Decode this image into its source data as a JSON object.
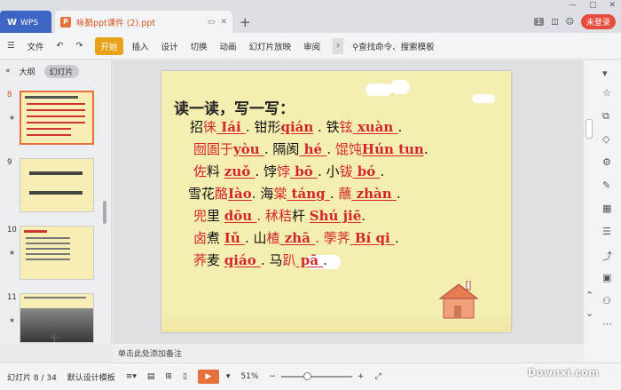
{
  "titlebar": {
    "wps_logo": "W",
    "wps_label": "WPS",
    "doc_icon": "P",
    "doc_title": "咏鹅ppt课件 (2).ppt",
    "new_tab": "+",
    "badge": "1",
    "login": "未登录"
  },
  "ribbon": {
    "file": "文件",
    "start": "开始",
    "tabs": [
      "插入",
      "设计",
      "切换",
      "动画",
      "幻灯片放映",
      "审阅"
    ],
    "search": "查找命令、搜索模板"
  },
  "leftpane": {
    "outline": "大纲",
    "slides": "幻灯片",
    "thumbs": [
      {
        "num": "8",
        "starred": true,
        "selected": true
      },
      {
        "num": "9",
        "starred": false,
        "selected": false
      },
      {
        "num": "10",
        "starred": true,
        "selected": false
      },
      {
        "num": "11",
        "starred": true,
        "selected": false
      }
    ],
    "add": "+"
  },
  "slide": {
    "heading": "读一读，写一写：",
    "lines": [
      [
        {
          "t": "招",
          "c": "k"
        },
        {
          "t": "徕",
          "c": "r"
        },
        {
          "t": "  Iái   ",
          "c": "p"
        },
        {
          "t": ". 钳形",
          "c": "k"
        },
        {
          "t": "qián",
          "c": "p"
        },
        {
          "t": " .  铁",
          "c": "k"
        },
        {
          "t": "铉",
          "c": "r"
        },
        {
          "t": " xuàn ",
          "c": "p"
        },
        {
          "t": ".",
          "c": "k"
        }
      ],
      [
        {
          "t": "囫圄于",
          "c": "r"
        },
        {
          "t": "yòu ",
          "c": "p"
        },
        {
          "t": ". 隔阂",
          "c": "k"
        },
        {
          "t": "  hé  ",
          "c": "p"
        },
        {
          "t": ".  ",
          "c": "k"
        },
        {
          "t": "馄饨",
          "c": "r"
        },
        {
          "t": "Hún tun",
          "c": "p"
        },
        {
          "t": ".",
          "c": "k"
        }
      ],
      [
        {
          "t": "佐",
          "c": "r"
        },
        {
          "t": "料 ",
          "c": "k"
        },
        {
          "t": "zuǒ ",
          "c": "p"
        },
        {
          "t": ". 饽",
          "c": "k"
        },
        {
          "t": "饽",
          "c": "r"
        },
        {
          "t": " bō  ",
          "c": "p"
        },
        {
          "t": ".  小",
          "c": "k"
        },
        {
          "t": "钹",
          "c": "r"
        },
        {
          "t": "  bó  ",
          "c": "p"
        },
        {
          "t": ".",
          "c": "k"
        }
      ],
      [
        {
          "t": "雪花",
          "c": "k"
        },
        {
          "t": "酪",
          "c": "r"
        },
        {
          "t": "Iào",
          "c": "p"
        },
        {
          "t": ". 海",
          "c": "k"
        },
        {
          "t": "棠",
          "c": "r"
        },
        {
          "t": " táng ",
          "c": "p"
        },
        {
          "t": ".  ",
          "c": "k"
        },
        {
          "t": "蘸",
          "c": "r"
        },
        {
          "t": "  zhàn ",
          "c": "p"
        },
        {
          "t": ".",
          "c": "k"
        }
      ],
      [
        {
          "t": "兜",
          "c": "r"
        },
        {
          "t": "里  ",
          "c": "k"
        },
        {
          "t": "dōu ",
          "c": "p"
        },
        {
          "t": ". 秫秸",
          "c": "r"
        },
        {
          "t": "杆  ",
          "c": "k"
        },
        {
          "t": "Shú jiē",
          "c": "p"
        },
        {
          "t": ".",
          "c": "k"
        }
      ],
      [
        {
          "t": "卤",
          "c": "r"
        },
        {
          "t": "煮  ",
          "c": "k"
        },
        {
          "t": "Iǔ   ",
          "c": "p"
        },
        {
          "t": ". 山",
          "c": "k"
        },
        {
          "t": "楂",
          "c": "r"
        },
        {
          "t": " zhā ",
          "c": "p"
        },
        {
          "t": ". 荸荠",
          "c": "r"
        },
        {
          "t": "  Bí  qi ",
          "c": "p"
        },
        {
          "t": ".",
          "c": "k"
        }
      ],
      [
        {
          "t": "荞",
          "c": "r"
        },
        {
          "t": "麦  ",
          "c": "k"
        },
        {
          "t": "qiáo  ",
          "c": "p"
        },
        {
          "t": ". 马",
          "c": "k"
        },
        {
          "t": "趴",
          "c": "r"
        },
        {
          "t": "  pā  ",
          "c": "p"
        },
        {
          "t": ".",
          "c": "k"
        }
      ]
    ]
  },
  "notes": {
    "placeholder": "单击此处添加备注"
  },
  "status": {
    "slide_info": "幻灯片 8 / 34",
    "theme": "默认设计模板",
    "zoom": "51%",
    "zoom_fraction": 0.51,
    "watermark": "Downxi.com"
  },
  "colors": {
    "accent": "#e8703a",
    "slide_bg": "#f5eeb1",
    "red_text": "#d3262c",
    "wps_blue": "#3d65c4"
  }
}
